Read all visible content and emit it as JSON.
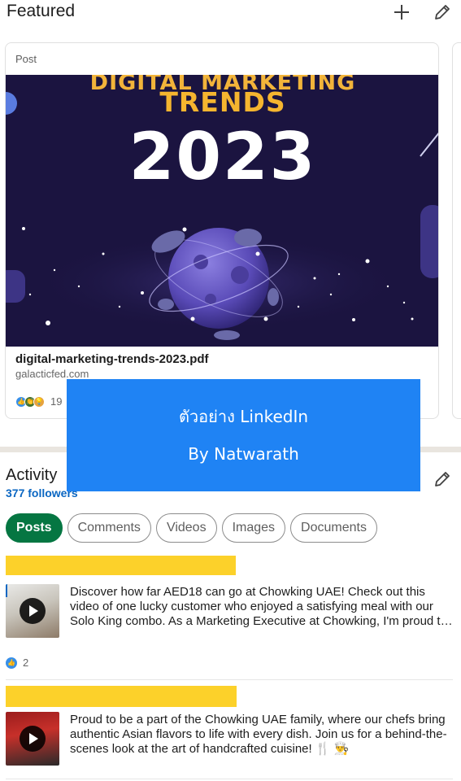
{
  "featured": {
    "title": "Featured",
    "add_icon": "plus-icon",
    "edit_icon": "pencil-icon"
  },
  "card": {
    "type_label": "Post",
    "image_text": {
      "line1": "DIGITAL MARKETING",
      "line2": "TRENDS",
      "line3": "2023"
    },
    "doc_title": "digital-marketing-trends-2023.pdf",
    "source": "galacticfed.com",
    "reaction_count": "19",
    "reaction_icons": [
      "like-icon",
      "celebrate-icon",
      "insightful-icon"
    ]
  },
  "activity": {
    "title": "Activity",
    "followers": "377 followers",
    "edit_icon": "pencil-icon",
    "tabs": [
      {
        "label": "Posts",
        "active": true
      },
      {
        "label": "Comments",
        "active": false
      },
      {
        "label": "Videos",
        "active": false
      },
      {
        "label": "Images",
        "active": false
      },
      {
        "label": "Documents",
        "active": false
      }
    ],
    "posts": [
      {
        "text": "Discover how far AED18 can go at Chowking UAE! Check out this video of one lucky customer who enjoyed a satisfying meal with our Solo King combo. As a Marketing Executive at Chowking, I'm proud t…",
        "reaction_count": "2",
        "thumbnail_icon": "play-icon"
      },
      {
        "text": "Proud to be a part of the Chowking UAE family, where our chefs bring authentic Asian flavors to life with every dish. Join us for a behind-the-scenes look at the art of handcrafted cuisine! 🍴 👨‍🍳",
        "thumbnail_icon": "play-icon"
      }
    ]
  },
  "watermark": {
    "line1": "ตัวอย่าง LinkedIn",
    "line2": "By Natwarath"
  },
  "colors": {
    "accent_blue": "#0a66c2",
    "active_chip": "#057642",
    "highlight_yellow": "#fcd12a",
    "watermark_blue": "#1f83f4",
    "image_bg": "#1b1440"
  }
}
